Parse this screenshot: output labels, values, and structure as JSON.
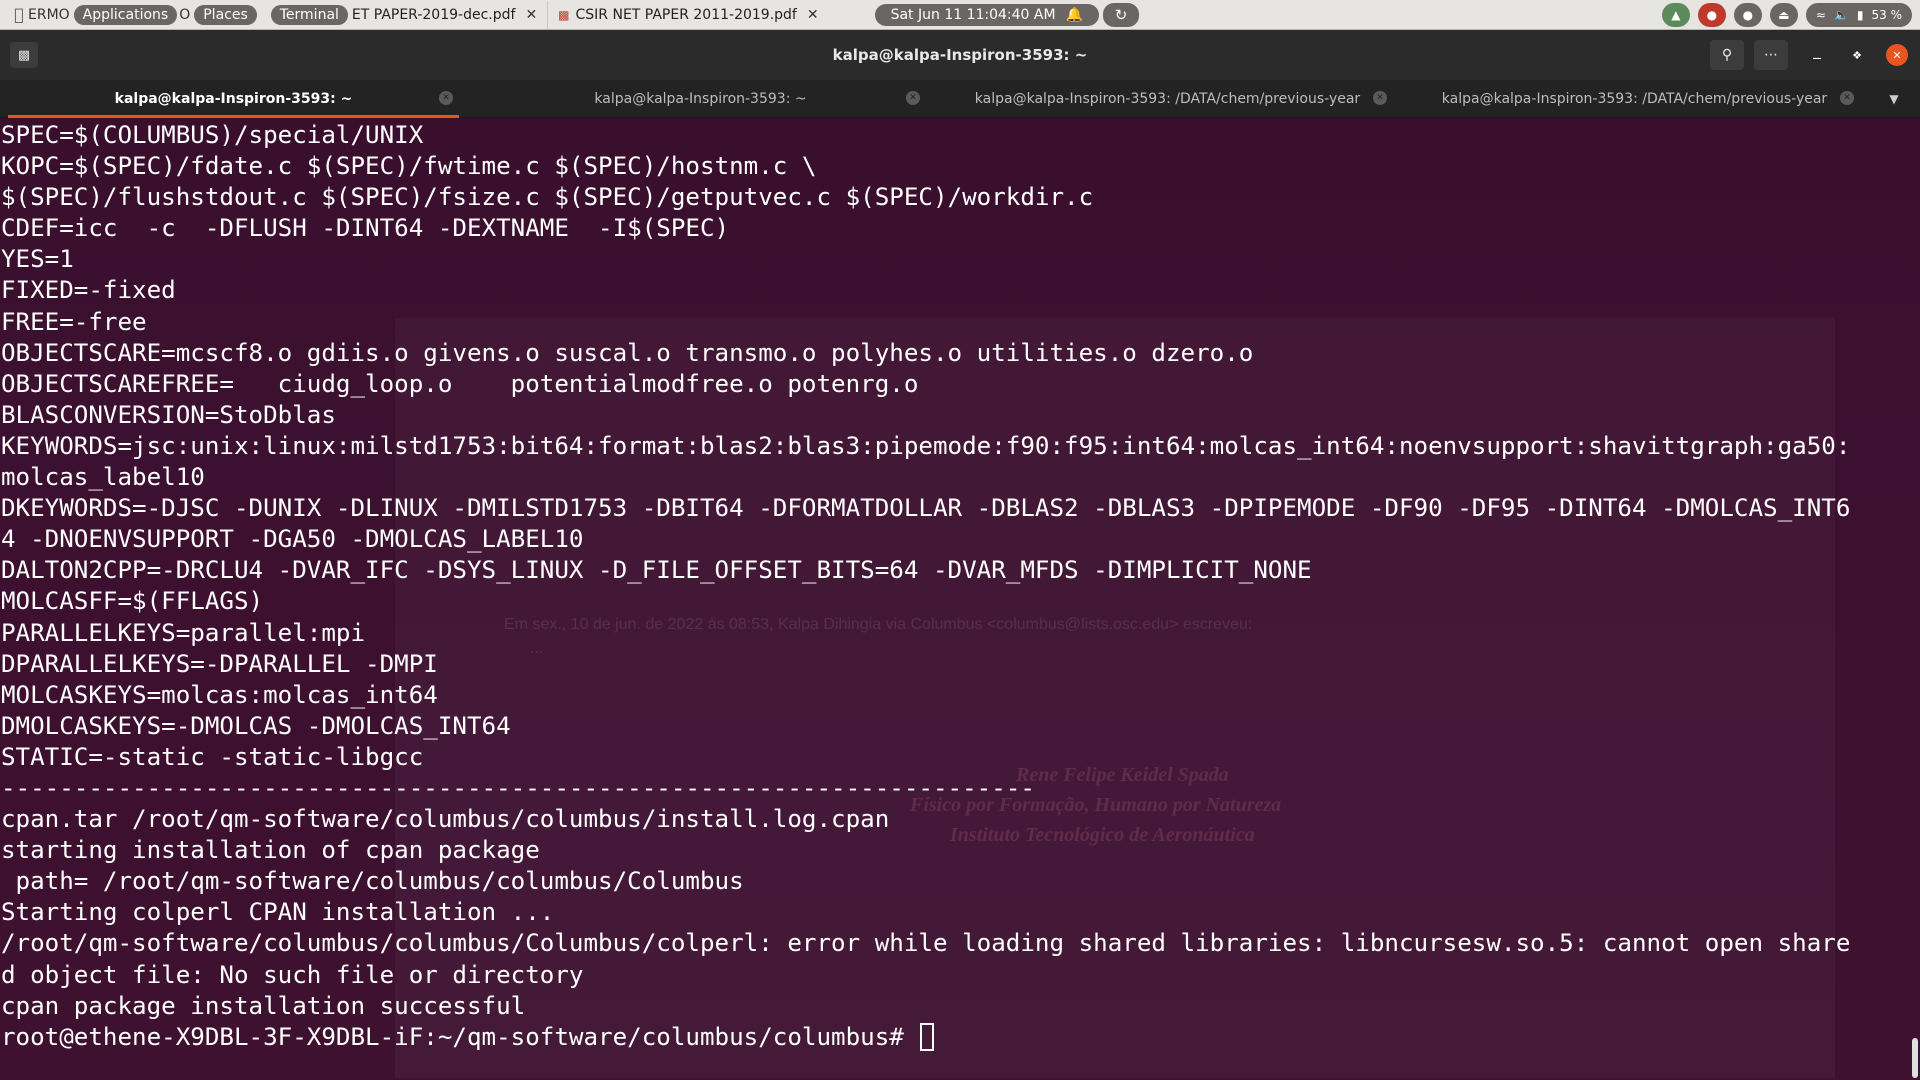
{
  "system_bar": {
    "apple_icon": "apple-icon",
    "ghost_text": "ERMO",
    "applications": "Applications",
    "ghost_text2": "O",
    "places": "Places",
    "terminal": "Terminal",
    "pdf_tab_1": "ET PAPER-2019-dec.pdf",
    "pdf_tab_2": "CSIR NET PAPER 2011-2019.pdf",
    "clock": "Sat Jun 11  11:04:40 AM",
    "battery": "53 %"
  },
  "window": {
    "title": "kalpa@kalpa-Inspiron-3593: ~"
  },
  "tabs": [
    {
      "label": "kalpa@kalpa-Inspiron-3593: ~"
    },
    {
      "label": "kalpa@kalpa-Inspiron-3593: ~"
    },
    {
      "label": "kalpa@kalpa-Inspiron-3593: /DATA/chem/previous-year"
    },
    {
      "label": "kalpa@kalpa-Inspiron-3593: /DATA/chem/previous-year"
    }
  ],
  "terminal": {
    "lines": [
      "SPEC=$(COLUMBUS)/special/UNIX",
      "KOPC=$(SPEC)/fdate.c $(SPEC)/fwtime.c $(SPEC)/hostnm.c \\",
      "$(SPEC)/flushstdout.c $(SPEC)/fsize.c $(SPEC)/getputvec.c $(SPEC)/workdir.c",
      "CDEF=icc  -c  -DFLUSH -DINT64 -DEXTNAME  -I$(SPEC)",
      "YES=1",
      "FIXED=-fixed",
      "FREE=-free",
      "OBJECTSCARE=mcscf8.o gdiis.o givens.o suscal.o transmo.o polyhes.o utilities.o dzero.o",
      "OBJECTSCAREFREE=   ciudg_loop.o    potentialmodfree.o potenrg.o",
      "BLASCONVERSION=StoDblas",
      "KEYWORDS=jsc:unix:linux:milstd1753:bit64:format:blas2:blas3:pipemode:f90:f95:int64:molcas_int64:noenvsupport:shavittgraph:ga50:",
      "molcas_label10",
      "DKEYWORDS=-DJSC -DUNIX -DLINUX -DMILSTD1753 -DBIT64 -DFORMATDOLLAR -DBLAS2 -DBLAS3 -DPIPEMODE -DF90 -DF95 -DINT64 -DMOLCAS_INT6",
      "4 -DNOENVSUPPORT -DGA50 -DMOLCAS_LABEL10",
      "DALTON2CPP=-DRCLU4 -DVAR_IFC -DSYS_LINUX -D_FILE_OFFSET_BITS=64 -DVAR_MFDS -DIMPLICIT_NONE",
      "MOLCASFF=$(FFLAGS)",
      "PARALLELKEYS=parallel:mpi",
      "DPARALLELKEYS=-DPARALLEL -DMPI",
      "MOLCASKEYS=molcas:molcas_int64",
      "DMOLCASKEYS=-DMOLCAS -DMOLCAS_INT64",
      "STATIC=-static -static-libgcc",
      "-----------------------------------------------------------------------",
      "cpan.tar /root/qm-software/columbus/columbus/install.log.cpan",
      "starting installation of cpan package",
      " path= /root/qm-software/columbus/columbus/Columbus",
      "Starting colperl CPAN installation ...",
      "/root/qm-software/columbus/columbus/Columbus/colperl: error while loading shared libraries: libncursesw.so.5: cannot open share",
      "d object file: No such file or directory",
      "cpan package installation successful"
    ],
    "prompt": "root@ethene-X9DBL-3F-X9DBL-iF:~/qm-software/columbus/columbus# "
  },
  "background_ghost": {
    "email_line": "Em sex., 10 de jun. de 2022 às 08:53, Kalpa Dihingia via Columbus <columbus@lists.osc.edu> escreveu:",
    "ellipsis": "...",
    "sig_name": "Rene Felipe Keidel Spada",
    "sig_line2": "Físico por Formação, Humano por Natureza",
    "sig_line3": "Instituto Tecnológico de Aeronáutica"
  },
  "colors": {
    "terminal_bg": "#3d1030",
    "accent": "#e95420",
    "text": "#ffffff"
  }
}
